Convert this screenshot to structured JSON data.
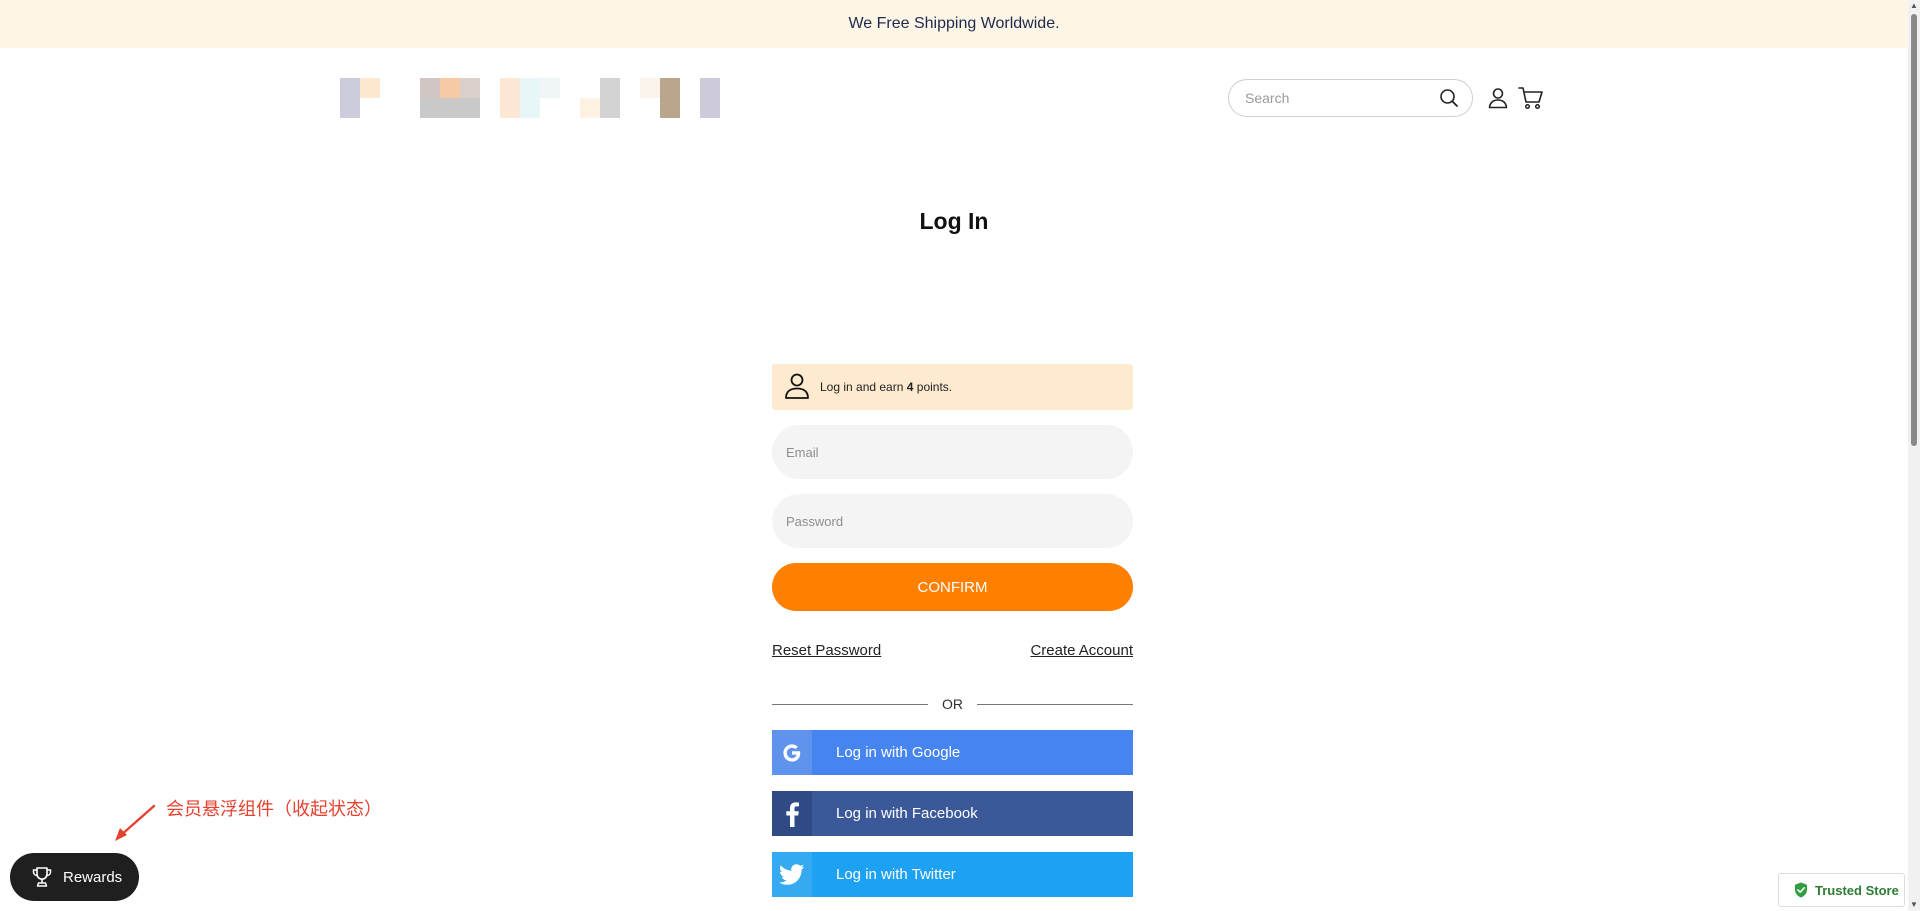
{
  "announcement": {
    "text": "We Free Shipping Worldwide."
  },
  "header": {
    "search": {
      "placeholder": "Search",
      "icon": "search-icon"
    },
    "account_icon": "user-icon",
    "cart_icon": "cart-icon"
  },
  "page": {
    "title": "Log In"
  },
  "points_banner": {
    "prefix": "Log in and earn ",
    "points": "4",
    "suffix": " points.",
    "icon": "user-outline-icon"
  },
  "form": {
    "email_placeholder": "Email",
    "password_placeholder": "Password",
    "confirm_label": "CONFIRM",
    "reset_password": "Reset Password",
    "create_account": "Create Account",
    "or_label": "OR"
  },
  "social": [
    {
      "label": "Log in with Google",
      "icon": "google-icon",
      "color": "#4685ef"
    },
    {
      "label": "Log in with Facebook",
      "icon": "facebook-icon",
      "color": "#3b5998"
    },
    {
      "label": "Log in with Twitter",
      "icon": "twitter-icon",
      "color": "#1da1f2"
    }
  ],
  "rewards": {
    "label": "Rewards",
    "icon": "trophy-icon"
  },
  "annotation": {
    "text": "会员悬浮组件（收起状态）"
  },
  "trusted_store": {
    "label": "Trusted Store",
    "icon": "shield-check-icon"
  },
  "colors": {
    "accent": "#ff7f00",
    "banner_bg": "#fdf5e6",
    "points_bg": "#feebcf"
  }
}
